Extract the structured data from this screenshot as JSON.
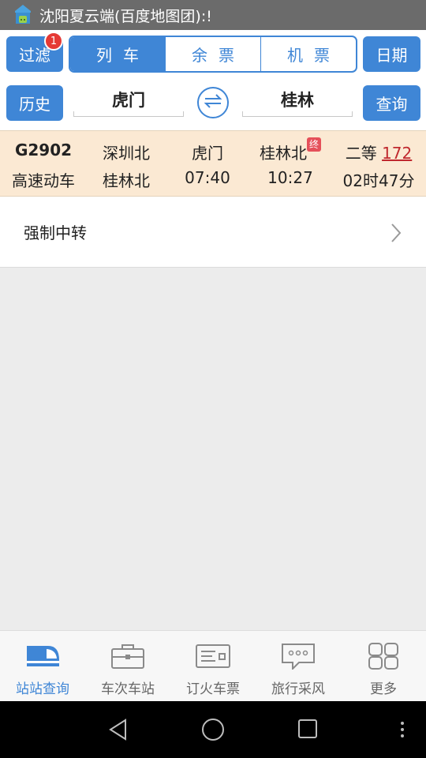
{
  "status_bar": {
    "title": "沈阳夏云端(百度地图团):!"
  },
  "toolbar": {
    "filter_label": "过滤",
    "filter_badge": "1",
    "date_label": "日期",
    "history_label": "历史",
    "query_label": "查询",
    "segments": [
      {
        "label": "列车",
        "active": true
      },
      {
        "label": "余票",
        "active": false
      },
      {
        "label": "机票",
        "active": false
      }
    ]
  },
  "search": {
    "from": "虎门",
    "to": "桂林"
  },
  "result": {
    "train_no": "G2902",
    "train_type": "高速动车",
    "origin": "深圳北",
    "terminal": "桂林北",
    "depart_station": "虎门",
    "arrive_station": "桂林北",
    "end_tag": "终",
    "depart_time": "07:40",
    "arrive_time": "10:27",
    "seat_class": "二等",
    "price": "172",
    "duration": "02时47分"
  },
  "transfer": {
    "label": "强制中转"
  },
  "bottom_nav": [
    {
      "label": "站站查询",
      "icon": "train-icon",
      "active": true
    },
    {
      "label": "车次车站",
      "icon": "briefcase-icon",
      "active": false
    },
    {
      "label": "订火车票",
      "icon": "ticket-icon",
      "active": false
    },
    {
      "label": "旅行采风",
      "icon": "chat-bubble-icon",
      "active": false
    },
    {
      "label": "更多",
      "icon": "grid-icon",
      "active": false
    }
  ],
  "colors": {
    "accent": "#3f86d6",
    "result_bg": "#fbe9d3",
    "price": "#c0282e",
    "badge": "#e53935"
  }
}
